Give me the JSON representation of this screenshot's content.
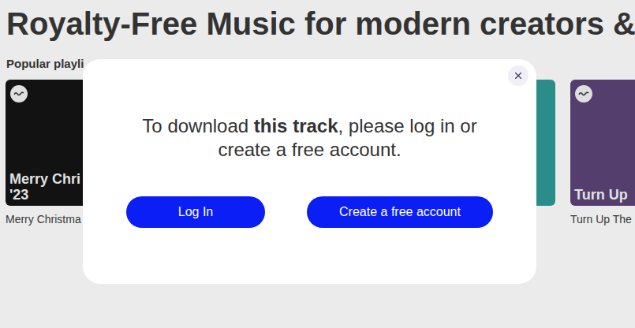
{
  "page": {
    "title": "Royalty-Free Music for modern creators &",
    "section": "Popular playli"
  },
  "cards": [
    {
      "title": [
        "Merry Chri",
        "'23"
      ],
      "caption": "Merry Christma",
      "color": "#141414"
    },
    {
      "title": [],
      "caption": "",
      "color": "#8c6f63"
    },
    {
      "title": [],
      "caption": "",
      "color": "#6e7f9a"
    },
    {
      "title": [],
      "caption": "",
      "color": "#2f9a96"
    },
    {
      "title": [
        "Turn Up"
      ],
      "caption": "Turn Up The",
      "color": "#5b4478"
    }
  ],
  "dialog": {
    "message": [
      {
        "text": "To download ",
        "bold": false
      },
      {
        "text": "this track",
        "bold": true
      },
      {
        "text": ", please log in or create a free account.",
        "bold": false
      }
    ],
    "buttons": [
      "Log In",
      "Create a free account"
    ]
  }
}
